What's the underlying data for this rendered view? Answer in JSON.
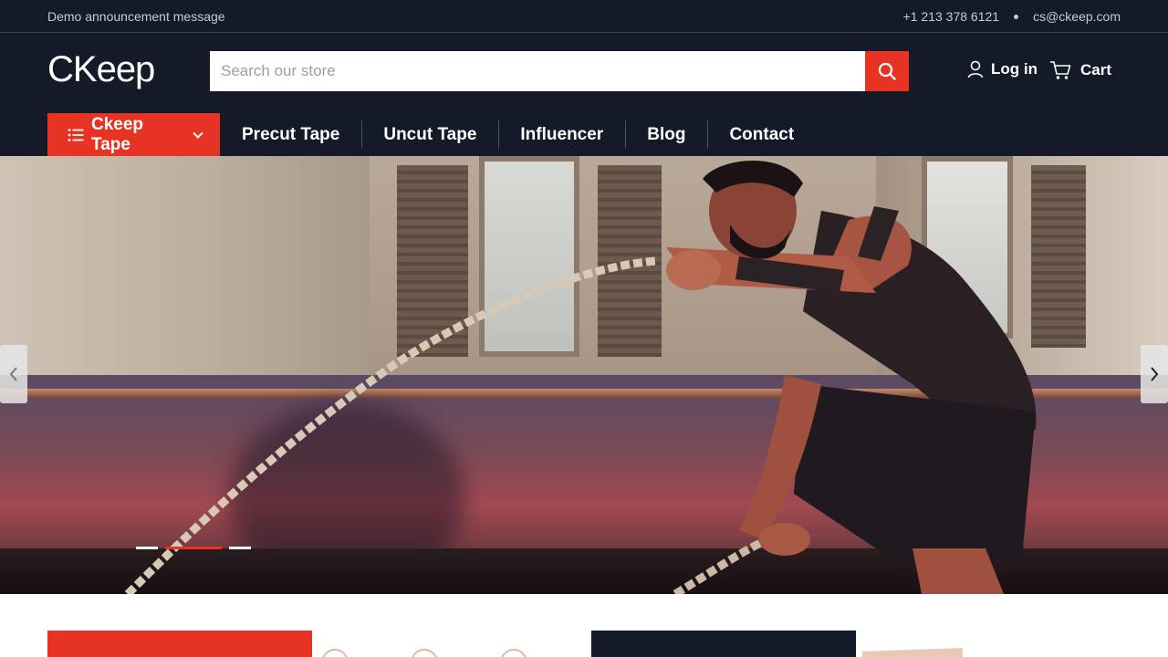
{
  "topbar": {
    "announcement": "Demo announcement message",
    "phone": "+1 213 378 6121",
    "email": "cs@ckeep.com"
  },
  "header": {
    "logo": "CKeep",
    "search_placeholder": "Search our store",
    "login_label": "Log in",
    "cart_label": "Cart"
  },
  "nav": {
    "primary_label": "Ckeep Tape",
    "items": [
      "Precut Tape",
      "Uncut Tape",
      "Influencer",
      "Blog",
      "Contact"
    ]
  },
  "slider": {
    "slide_count": 3,
    "active_slide": 2
  },
  "colors": {
    "accent": "#e63323",
    "header_bg": "#141a27"
  },
  "icons": [
    "search-icon",
    "user-icon",
    "cart-icon",
    "list-icon",
    "chevron-down-icon",
    "chevron-left-icon",
    "chevron-right-icon"
  ]
}
